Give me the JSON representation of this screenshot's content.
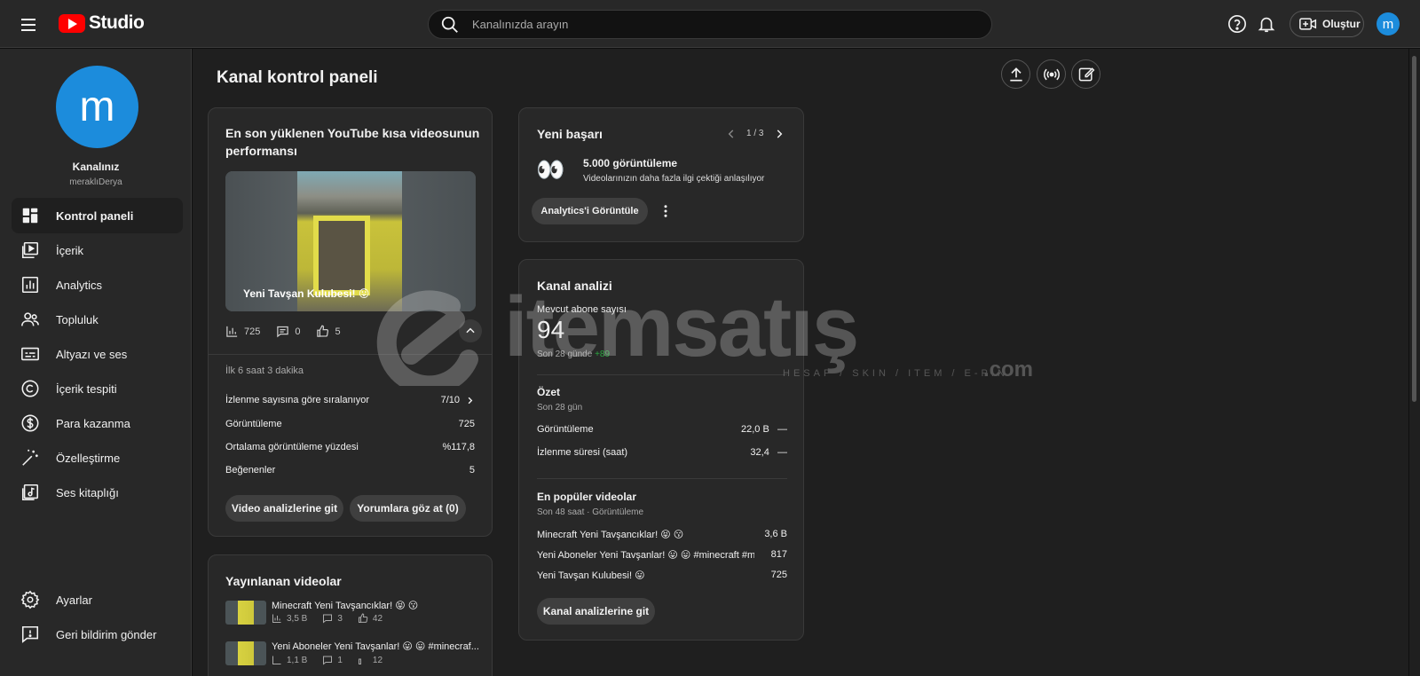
{
  "app": {
    "logo_text": "Studio"
  },
  "search": {
    "placeholder": "Kanalınızda arayın"
  },
  "header": {
    "create_label": "Oluştur",
    "avatar_letter": "m"
  },
  "sidebar": {
    "avatar_letter": "m",
    "channel_name": "Kanalınız",
    "handle": "meraklıDerya",
    "items": [
      {
        "label": "Kontrol paneli",
        "icon": "dashboard-icon",
        "active": true
      },
      {
        "label": "İçerik",
        "icon": "content-icon"
      },
      {
        "label": "Analytics",
        "icon": "analytics-icon"
      },
      {
        "label": "Topluluk",
        "icon": "community-icon"
      },
      {
        "label": "Altyazı ve ses",
        "icon": "subtitles-icon"
      },
      {
        "label": "İçerik tespiti",
        "icon": "copyright-icon"
      },
      {
        "label": "Para kazanma",
        "icon": "dollar-icon"
      },
      {
        "label": "Özelleştirme",
        "icon": "magic-wand-icon"
      },
      {
        "label": "Ses kitaplığı",
        "icon": "audio-library-icon"
      }
    ],
    "bottom": [
      {
        "label": "Ayarlar",
        "icon": "gear-icon"
      },
      {
        "label": "Geri bildirim gönder",
        "icon": "feedback-icon"
      }
    ]
  },
  "main": {
    "title": "Kanal kontrol paneli"
  },
  "latest_short": {
    "title": "En son yüklenen YouTube kısa videosunun performansı",
    "video_title": "Yeni Tavşan Kulubesi! 😛",
    "stats": {
      "views": "725",
      "comments": "0",
      "likes": "5"
    },
    "period": "İlk 6 saat 3 dakika",
    "rank_label": "İzlenme sayısına göre sıralanıyor",
    "rank_value": "7/10",
    "rows": [
      {
        "label": "Görüntüleme",
        "value": "725"
      },
      {
        "label": "Ortalama görüntüleme yüzdesi",
        "value": "%117,8"
      },
      {
        "label": "Beğenenler",
        "value": "5"
      }
    ],
    "btn_analytics": "Video analizlerine git",
    "btn_comments": "Yorumlara göz at (0)"
  },
  "published": {
    "title": "Yayınlanan videolar",
    "videos": [
      {
        "title": "Minecraft Yeni Tavşancıklar! 😝 😗",
        "views": "3,5 B",
        "comments": "3",
        "likes": "42"
      },
      {
        "title": "Yeni Aboneler Yeni Tavşanlar! 😛 😛 #minecraf...",
        "views": "1,1 B",
        "comments": "1",
        "likes": "12"
      }
    ]
  },
  "achievement": {
    "title": "Yeni başarı",
    "pager": "1 / 3",
    "emoji": "👀",
    "headline": "5.000 görüntüleme",
    "desc": "Videolarınızın daha fazla ilgi çektiği anlaşılıyor",
    "btn": "Analytics'i Görüntüle"
  },
  "channel_analytics": {
    "title": "Kanal analizi",
    "subs_label": "Mevcut abone sayısı",
    "subs_value": "94",
    "subs_period": "Son 28 günde",
    "subs_delta": "+89",
    "summary_title": "Özet",
    "summary_period": "Son 28 gün",
    "summary_rows": [
      {
        "label": "Görüntüleme",
        "value": "22,0 B",
        "trend": "—"
      },
      {
        "label": "İzlenme süresi (saat)",
        "value": "32,4",
        "trend": "—"
      }
    ],
    "top_title": "En popüler videolar",
    "top_period": "Son 48 saat · Görüntüleme",
    "top_videos": [
      {
        "title": "Minecraft Yeni Tavşancıklar! 😝 😗",
        "value": "3,6 B"
      },
      {
        "title": "Yeni Aboneler Yeni Tavşanlar! 😛 😛 #minecraft #m...",
        "value": "817"
      },
      {
        "title": "Yeni Tavşan Kulubesi! 😛",
        "value": "725"
      }
    ],
    "btn": "Kanal analizlerine git"
  },
  "watermark": {
    "brand": "itemsatış",
    "tagline": "HESAP / SKIN / ITEM / E-PIN",
    "domain": ".com"
  },
  "colors": {
    "accent_blue": "#1c8cdc",
    "positive_green": "#2ba640",
    "brand_red": "#ff0000"
  }
}
